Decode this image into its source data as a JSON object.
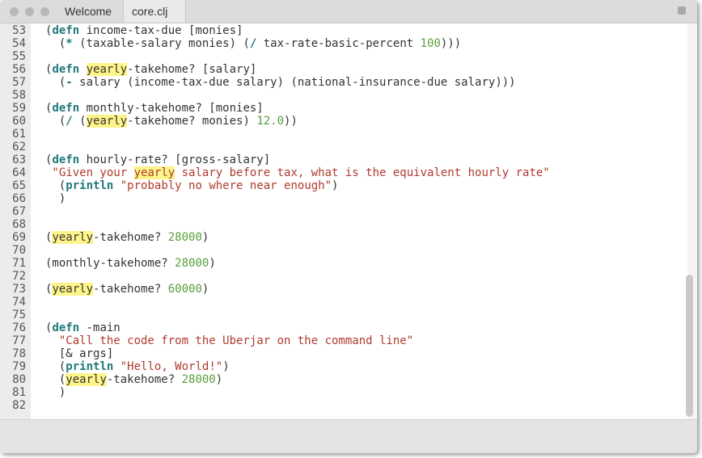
{
  "window": {
    "tabs": [
      {
        "label": "Welcome"
      },
      {
        "label": "core.clj"
      }
    ]
  },
  "editor": {
    "lines": [
      {
        "number": "53",
        "segments": [
          {
            "t": "(",
            "c": "p"
          },
          {
            "t": "defn",
            "c": "kw"
          },
          {
            "t": " income-tax-due [monies]",
            "c": "p"
          }
        ]
      },
      {
        "number": "54",
        "segments": [
          {
            "t": "  (",
            "c": "p"
          },
          {
            "t": "*",
            "c": "kw"
          },
          {
            "t": " (taxable-salary monies) (",
            "c": "p"
          },
          {
            "t": "/",
            "c": "kw"
          },
          {
            "t": " tax-rate-basic-percent ",
            "c": "p"
          },
          {
            "t": "100",
            "c": "num"
          },
          {
            "t": ")))",
            "c": "p"
          }
        ]
      },
      {
        "number": "55",
        "segments": []
      },
      {
        "number": "56",
        "segments": [
          {
            "t": "(",
            "c": "p"
          },
          {
            "t": "defn",
            "c": "kw"
          },
          {
            "t": " ",
            "c": "p"
          },
          {
            "t": "yearly",
            "c": "hl"
          },
          {
            "t": "-takehome? [salary]",
            "c": "p"
          }
        ]
      },
      {
        "number": "57",
        "segments": [
          {
            "t": "  (",
            "c": "p"
          },
          {
            "t": "-",
            "c": "kw"
          },
          {
            "t": " salary (income-tax-due salary) (national-insurance-due salary)))",
            "c": "p"
          }
        ]
      },
      {
        "number": "58",
        "segments": []
      },
      {
        "number": "59",
        "segments": [
          {
            "t": "(",
            "c": "p"
          },
          {
            "t": "defn",
            "c": "kw"
          },
          {
            "t": " monthly-takehome? [monies]",
            "c": "p"
          }
        ]
      },
      {
        "number": "60",
        "segments": [
          {
            "t": "  (",
            "c": "p"
          },
          {
            "t": "/",
            "c": "kw"
          },
          {
            "t": " (",
            "c": "p"
          },
          {
            "t": "yearly",
            "c": "hl"
          },
          {
            "t": "-takehome? monies) ",
            "c": "p"
          },
          {
            "t": "12.0",
            "c": "num"
          },
          {
            "t": "))",
            "c": "p"
          }
        ]
      },
      {
        "number": "61",
        "segments": []
      },
      {
        "number": "62",
        "segments": []
      },
      {
        "number": "63",
        "segments": [
          {
            "t": "(",
            "c": "p"
          },
          {
            "t": "defn",
            "c": "kw"
          },
          {
            "t": " hourly-rate? [gross-salary]",
            "c": "p"
          }
        ]
      },
      {
        "number": "64",
        "segments": [
          {
            "t": " \"Given your ",
            "c": "str"
          },
          {
            "t": "yearly",
            "c": "hl str"
          },
          {
            "t": " salary before tax, what is the equivalent hourly rate\"",
            "c": "str"
          }
        ]
      },
      {
        "number": "65",
        "segments": [
          {
            "t": "  (",
            "c": "p"
          },
          {
            "t": "println",
            "c": "kw"
          },
          {
            "t": " ",
            "c": "p"
          },
          {
            "t": "\"probably no where near enough\"",
            "c": "str"
          },
          {
            "t": ")",
            "c": "p"
          }
        ]
      },
      {
        "number": "66",
        "segments": [
          {
            "t": "  )",
            "c": "p"
          }
        ]
      },
      {
        "number": "67",
        "segments": []
      },
      {
        "number": "68",
        "segments": []
      },
      {
        "number": "69",
        "segments": [
          {
            "t": "(",
            "c": "p"
          },
          {
            "t": "yearly",
            "c": "hl"
          },
          {
            "t": "-takehome? ",
            "c": "p"
          },
          {
            "t": "28000",
            "c": "num"
          },
          {
            "t": ")",
            "c": "p"
          }
        ]
      },
      {
        "number": "70",
        "segments": []
      },
      {
        "number": "71",
        "segments": [
          {
            "t": "(monthly-takehome? ",
            "c": "p"
          },
          {
            "t": "28000",
            "c": "num"
          },
          {
            "t": ")",
            "c": "p"
          }
        ]
      },
      {
        "number": "72",
        "segments": []
      },
      {
        "number": "73",
        "segments": [
          {
            "t": "(",
            "c": "p"
          },
          {
            "t": "yearly",
            "c": "hl"
          },
          {
            "t": "-takehome? ",
            "c": "p"
          },
          {
            "t": "60000",
            "c": "num"
          },
          {
            "t": ")",
            "c": "p"
          }
        ]
      },
      {
        "number": "74",
        "segments": []
      },
      {
        "number": "75",
        "segments": []
      },
      {
        "number": "76",
        "segments": [
          {
            "t": "(",
            "c": "p"
          },
          {
            "t": "defn",
            "c": "kw"
          },
          {
            "t": " -main",
            "c": "p"
          }
        ]
      },
      {
        "number": "77",
        "segments": [
          {
            "t": "  \"Call the code from the Uberjar on the command line\"",
            "c": "str"
          }
        ]
      },
      {
        "number": "78",
        "segments": [
          {
            "t": "  [& args]",
            "c": "p"
          }
        ]
      },
      {
        "number": "79",
        "segments": [
          {
            "t": "  (",
            "c": "p"
          },
          {
            "t": "println",
            "c": "kw"
          },
          {
            "t": " ",
            "c": "p"
          },
          {
            "t": "\"Hello, World!\"",
            "c": "str"
          },
          {
            "t": ")",
            "c": "p"
          }
        ]
      },
      {
        "number": "80",
        "segments": [
          {
            "t": "  (",
            "c": "p"
          },
          {
            "t": "yearly",
            "c": "hl"
          },
          {
            "t": "-takehome? ",
            "c": "p"
          },
          {
            "t": "28000",
            "c": "num"
          },
          {
            "t": ")",
            "c": "p"
          }
        ]
      },
      {
        "number": "81",
        "segments": [
          {
            "t": "  )",
            "c": "p"
          }
        ]
      },
      {
        "number": "82",
        "segments": []
      }
    ]
  }
}
